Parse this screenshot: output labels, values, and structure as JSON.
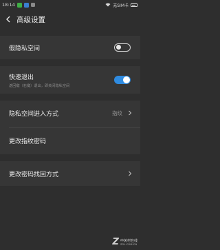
{
  "status_bar": {
    "time": "18:14",
    "carrier": "无SIM卡"
  },
  "header": {
    "title": "高级设置"
  },
  "settings": {
    "fake_private_space": {
      "label": "假隐私空间",
      "enabled": false
    },
    "quick_exit": {
      "label": "快速退出",
      "description": "返回键（右键）退出，即关闭隐私空间",
      "enabled": true
    },
    "entry_method": {
      "label": "隐私空间进入方式",
      "value": "指纹"
    },
    "change_fingerprint_password": {
      "label": "更改指纹密码"
    },
    "change_recovery_method": {
      "label": "更改密码找回方式"
    }
  },
  "watermark": {
    "name": "中关村在线",
    "url": "ZOL.COM.CN"
  },
  "colors": {
    "background": "#2e2e2e",
    "section": "#363636",
    "accent": "#2f8be0"
  }
}
